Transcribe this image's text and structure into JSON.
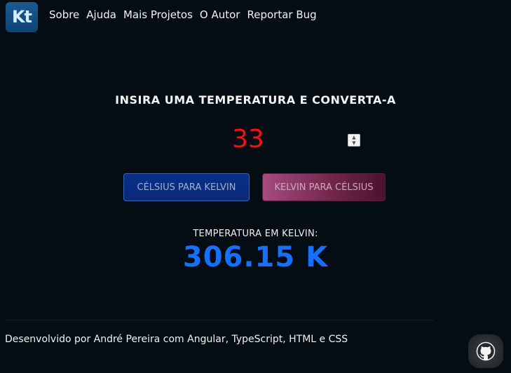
{
  "logo": {
    "text": "Kt"
  },
  "nav": {
    "items": [
      {
        "label": "Sobre"
      },
      {
        "label": "Ajuda"
      },
      {
        "label": "Mais Projetos"
      },
      {
        "label": "O Autor"
      },
      {
        "label": "Reportar Bug"
      }
    ]
  },
  "converter": {
    "heading": "INSIRA UMA TEMPERATURA E CONVERTA-A",
    "input_value": "33",
    "celsius_to_kelvin_label": "CÉLSIUS PARA KELVIN",
    "kelvin_to_celsius_label": "KELVIN PARA CÉLSIUS"
  },
  "result": {
    "label": "TEMPERATURA EM KELVIN:",
    "value": "306.15 K"
  },
  "footer": {
    "credits": "Desenvolvido por André Pereira com Angular, TypeScript, HTML e CSS",
    "github_icon": "github-icon"
  },
  "colors": {
    "background": "#030d13",
    "input_text": "#ff1010",
    "result_text": "#1470ff",
    "c2k_button": "#0a2f8a",
    "k2c_button": "#a64b7e"
  }
}
